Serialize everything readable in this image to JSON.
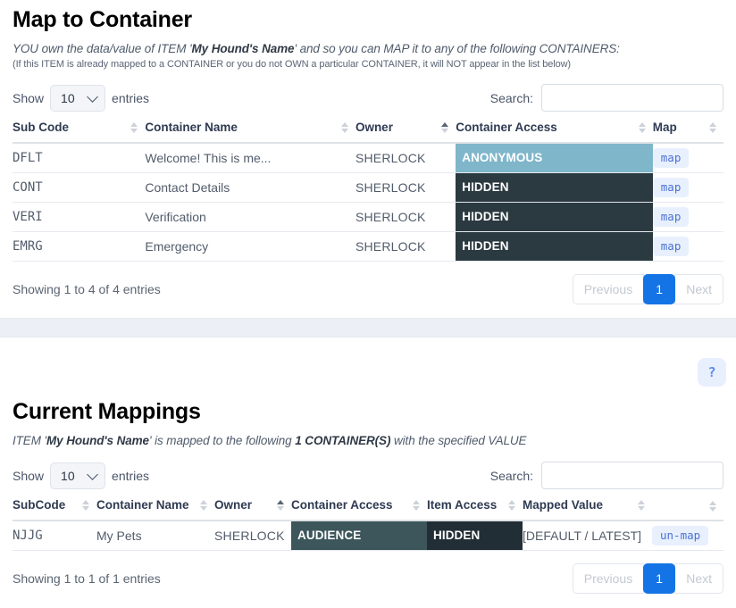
{
  "map_section": {
    "title": "Map to Container",
    "subtitle_pre": "YOU own the data/value of ITEM '",
    "subtitle_item": "My Hound's Name",
    "subtitle_post": "' and so you can MAP it to any of the following CONTAINERS:",
    "subnote": "(If this ITEM is already mapped to a CONTAINER or you do not OWN a particular CONTAINER, it will NOT appear in the list below)",
    "show_label": "Show",
    "entries_label": "entries",
    "page_length": "10",
    "search_label": "Search:",
    "search_value": "",
    "search_placeholder": "",
    "columns": [
      {
        "label": "Sub Code",
        "sort": "none"
      },
      {
        "label": "Container Name",
        "sort": "none"
      },
      {
        "label": "Owner",
        "sort": "asc"
      },
      {
        "label": "Container Access",
        "sort": "none"
      },
      {
        "label": "Map",
        "sort": "none"
      }
    ],
    "rows": [
      {
        "sub_code": "DFLT",
        "container_name": "Welcome! This is me...",
        "owner": "SHERLOCK",
        "access": "ANONYMOUS",
        "access_color": "#7fb6ca",
        "action": "map"
      },
      {
        "sub_code": "CONT",
        "container_name": "Contact Details",
        "owner": "SHERLOCK",
        "access": "HIDDEN",
        "access_color": "#2b3940",
        "action": "map"
      },
      {
        "sub_code": "VERI",
        "container_name": "Verification",
        "owner": "SHERLOCK",
        "access": "HIDDEN",
        "access_color": "#2b3940",
        "action": "map"
      },
      {
        "sub_code": "EMRG",
        "container_name": "Emergency",
        "owner": "SHERLOCK",
        "access": "HIDDEN",
        "access_color": "#2b3940",
        "action": "map"
      }
    ],
    "info": "Showing 1 to 4 of 4 entries",
    "pagination": {
      "previous": "Previous",
      "current_page": "1",
      "next": "Next"
    }
  },
  "help_button": {
    "label": "?"
  },
  "mappings_section": {
    "title": "Current Mappings",
    "subtitle_pre": "ITEM '",
    "subtitle_item": "My Hound's Name",
    "subtitle_mid": "' is mapped to the following ",
    "subtitle_count": "1 CONTAINER(S)",
    "subtitle_post": " with the specified VALUE",
    "show_label": "Show",
    "entries_label": "entries",
    "page_length": "10",
    "search_label": "Search:",
    "search_value": "",
    "search_placeholder": "",
    "columns": [
      {
        "label": "SubCode",
        "sort": "none"
      },
      {
        "label": "Container Name",
        "sort": "none"
      },
      {
        "label": "Owner",
        "sort": "asc"
      },
      {
        "label": "Container Access",
        "sort": "none"
      },
      {
        "label": "Item Access",
        "sort": "none"
      },
      {
        "label": "Mapped Value",
        "sort": "none"
      },
      {
        "label": "",
        "sort": "none"
      }
    ],
    "rows": [
      {
        "sub_code": "NJJG",
        "container_name": "My Pets",
        "owner": "SHERLOCK",
        "container_access": "AUDIENCE",
        "container_access_color": "#3d565c",
        "item_access": "HIDDEN",
        "item_access_color": "#222e35",
        "mapped_value": "[DEFAULT / LATEST]",
        "action": "un-map"
      }
    ],
    "info": "Showing 1 to 1 of 1 entries",
    "pagination": {
      "previous": "Previous",
      "current_page": "1",
      "next": "Next"
    }
  },
  "theme": {
    "link_blue": "#4a72d4",
    "pager_active": "#1574e5",
    "pill_bg": "#e8f0fe",
    "band_bg": "#eceff5"
  }
}
